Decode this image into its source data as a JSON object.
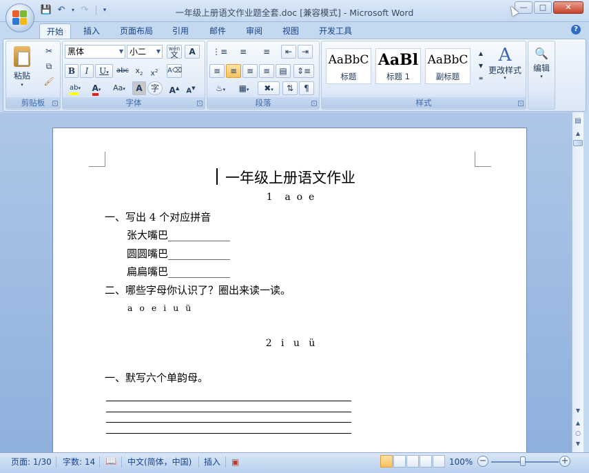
{
  "window": {
    "title": "一年级上册语文作业题全套.doc [兼容模式] - Microsoft Word"
  },
  "tabs": [
    "开始",
    "插入",
    "页面布局",
    "引用",
    "邮件",
    "审阅",
    "视图",
    "开发工具"
  ],
  "ribbon": {
    "clipboard": {
      "paste_label": "粘贴",
      "group_label": "剪贴板"
    },
    "font": {
      "font_name": "黑体",
      "font_size": "小二",
      "phonetic_label": "wén",
      "group_label": "字体"
    },
    "paragraph": {
      "group_label": "段落"
    },
    "styles": {
      "items": [
        {
          "sample": "AaBbC",
          "name": "标题"
        },
        {
          "sample": "AaBl",
          "name": "标题 1"
        },
        {
          "sample": "AaBbC",
          "name": "副标题"
        }
      ],
      "change_styles_label": "更改样式",
      "group_label": "样式"
    },
    "editing": {
      "label": "编辑"
    }
  },
  "document": {
    "title": "一年级上册语文作业",
    "lesson1_heading": "1    a  o  e",
    "q1": "一、写出 4 个对应拼音",
    "q1_items": [
      "张大嘴巴____________",
      "圆圆嘴巴____________",
      "扁扁嘴巴____________"
    ],
    "q2": "二、哪些字母你认识了？圈出来读一读。",
    "q2_letters": "a o e i u ü",
    "lesson2_heading": "2   i   u   ü",
    "q3": "一、默写六个单韵母。"
  },
  "status": {
    "page": "页面: 1/30",
    "words": "字数: 14",
    "language": "中文(简体，中国)",
    "mode": "插入",
    "zoom": "100%"
  }
}
